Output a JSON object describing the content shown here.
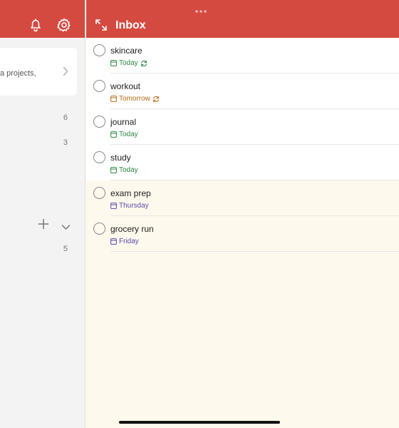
{
  "sidebar": {
    "card_text": "ld extra projects,",
    "counts": [
      "6",
      "3",
      "5"
    ]
  },
  "inbox": {
    "title": "Inbox"
  },
  "tasks": [
    {
      "name": "skincare",
      "due": "Today",
      "color": "#2a8a3e",
      "repeat": true
    },
    {
      "name": "workout",
      "due": "Tomorrow",
      "color": "#b86a19",
      "repeat": true
    },
    {
      "name": "journal",
      "due": "Today",
      "color": "#2a8a3e",
      "repeat": false
    },
    {
      "name": "study",
      "due": "Today",
      "color": "#2a8a3e",
      "repeat": false
    },
    {
      "name": "exam prep",
      "due": "Thursday",
      "color": "#5a4aae",
      "repeat": false
    },
    {
      "name": "grocery run",
      "due": "Friday",
      "color": "#5a4aae",
      "repeat": false
    }
  ],
  "colors": {
    "header": "#d54a40",
    "background": "#fdf9ec"
  }
}
